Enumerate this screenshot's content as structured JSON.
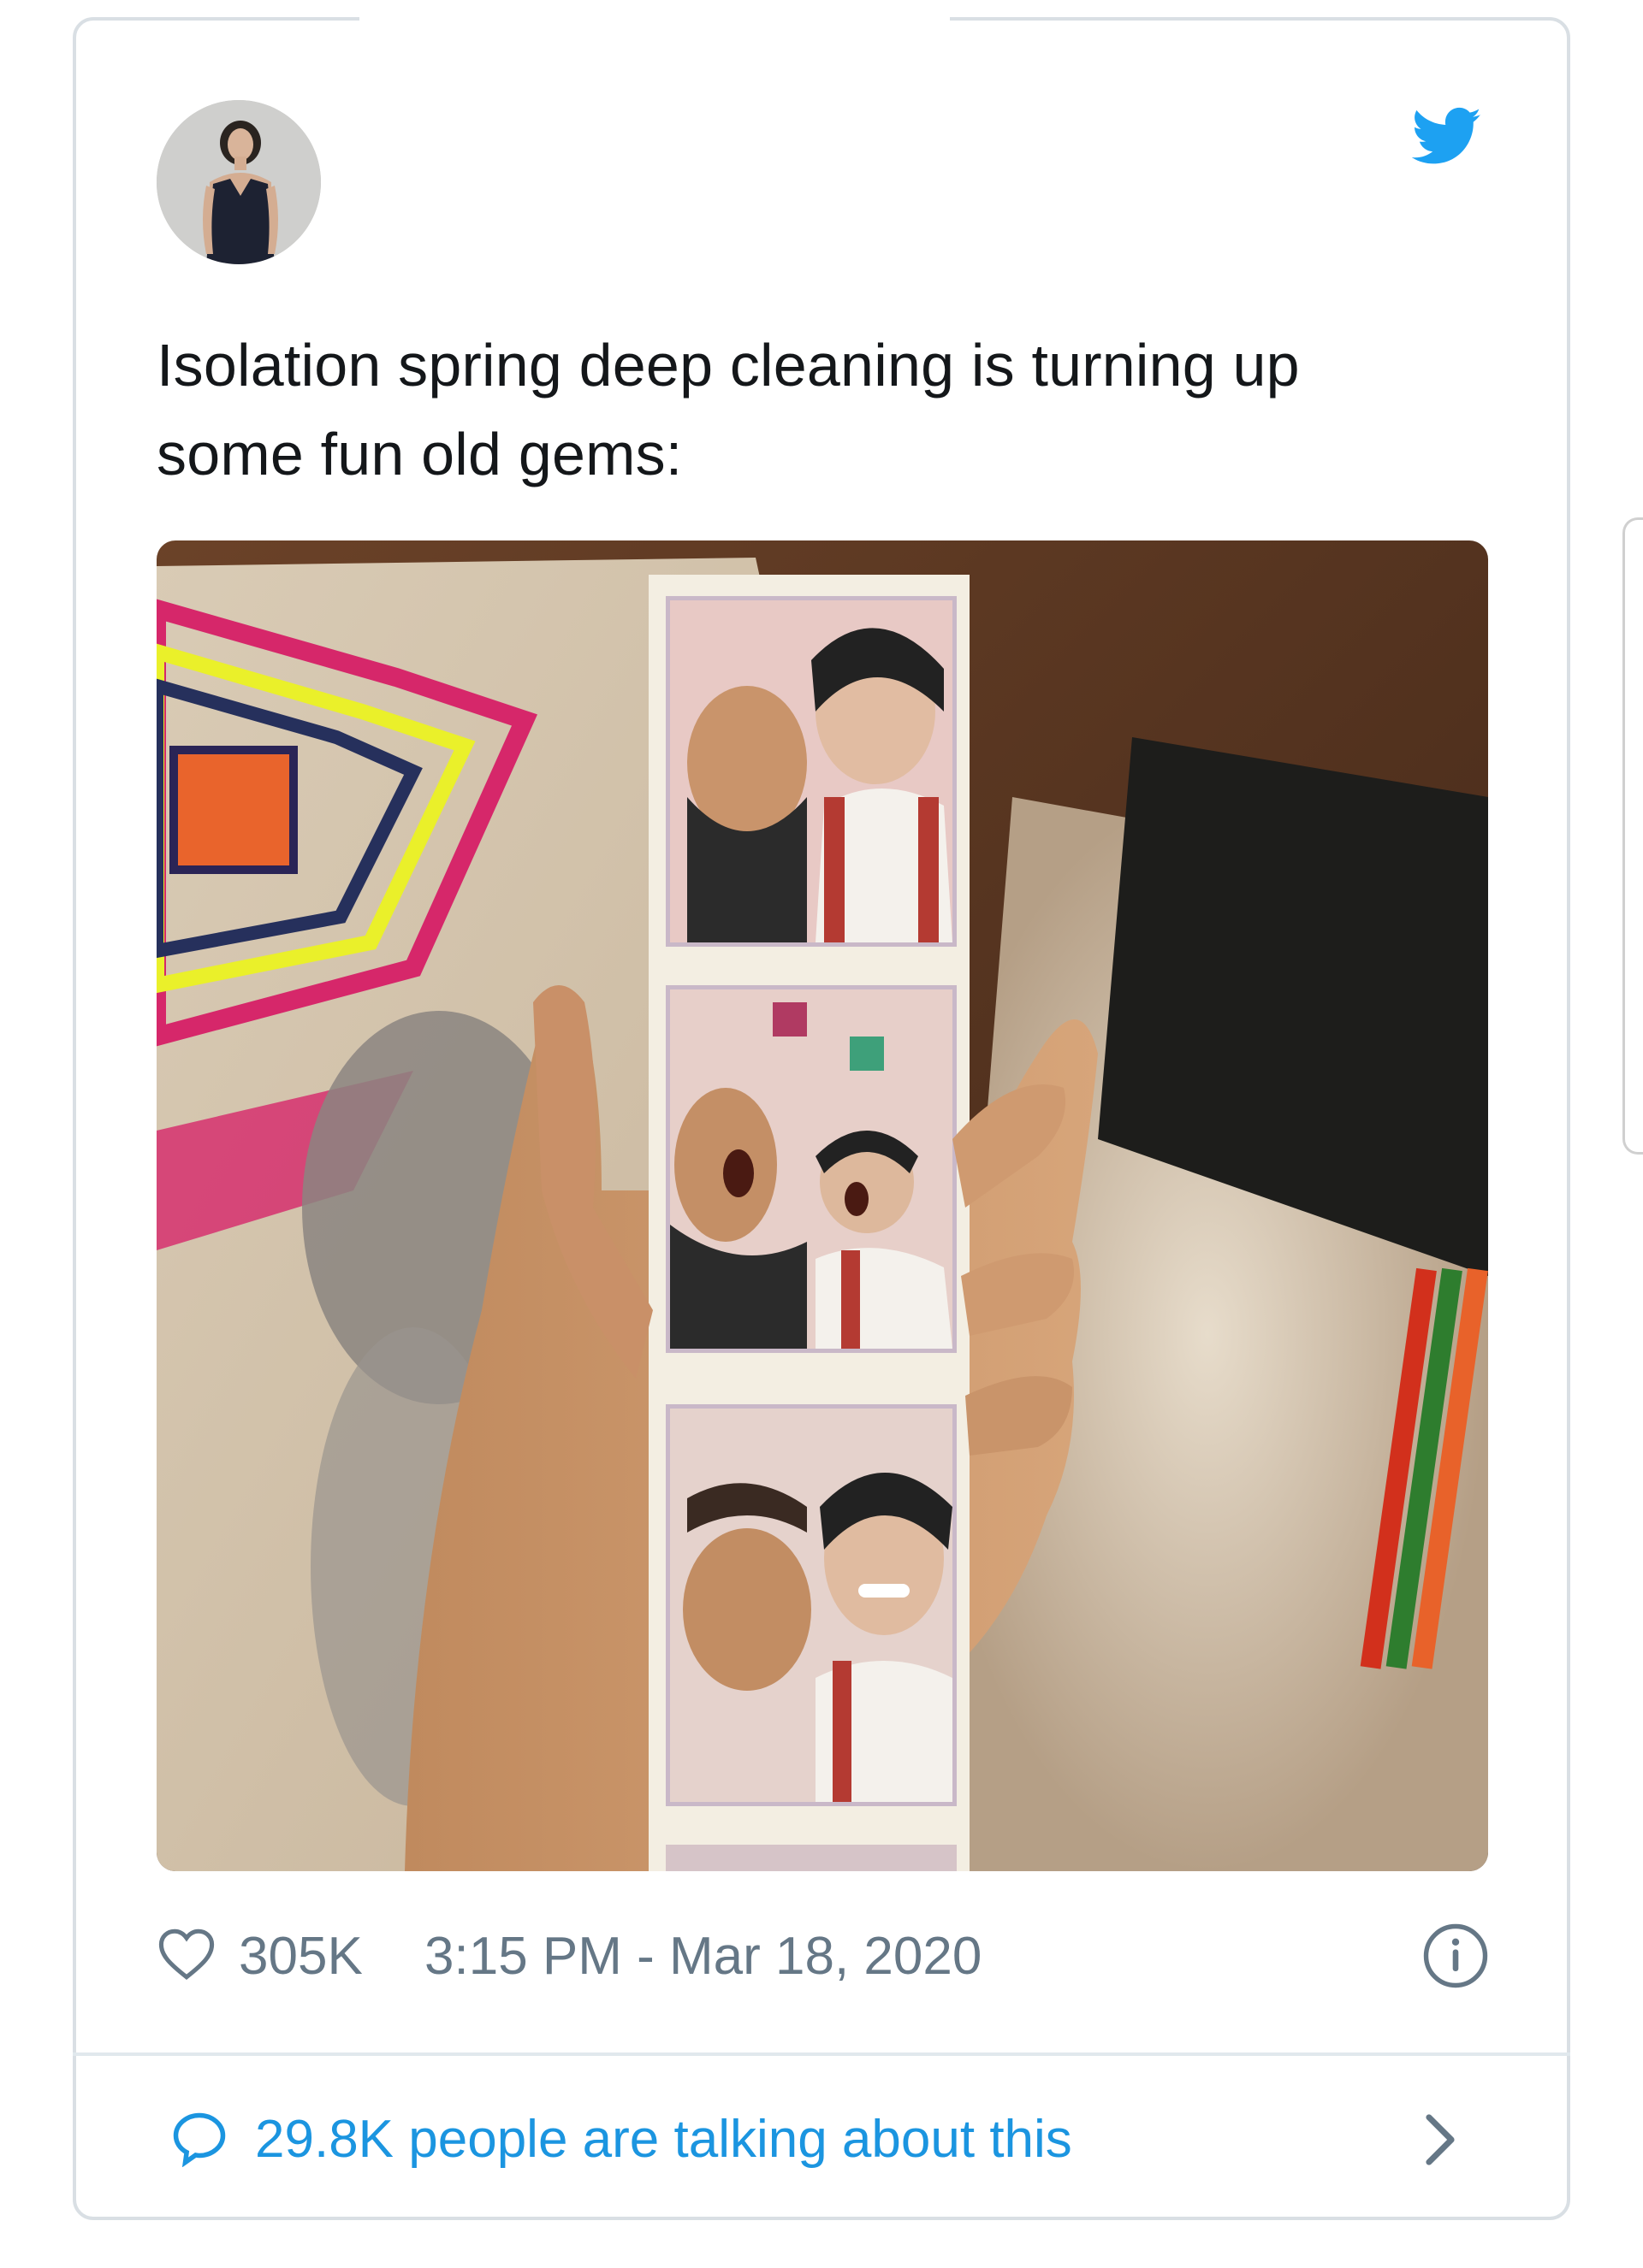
{
  "tweet": {
    "text": "Isolation spring deep cleaning is turning up some fun old gems:",
    "likes": "305K",
    "timestamp": "3:15 PM - Mar 18, 2020"
  },
  "footer": {
    "talk_text": "29.8K people are talking about this"
  },
  "icons": {
    "brand": "twitter-bird-icon",
    "like": "heart-icon",
    "info": "info-icon",
    "reply": "speech-bubble-icon",
    "more": "chevron-right-icon"
  },
  "colors": {
    "twitter_blue": "#1da1f2",
    "link_blue": "#1b95e0",
    "text_primary": "#14171a",
    "text_secondary": "#657786",
    "border": "#d9dfe4"
  }
}
